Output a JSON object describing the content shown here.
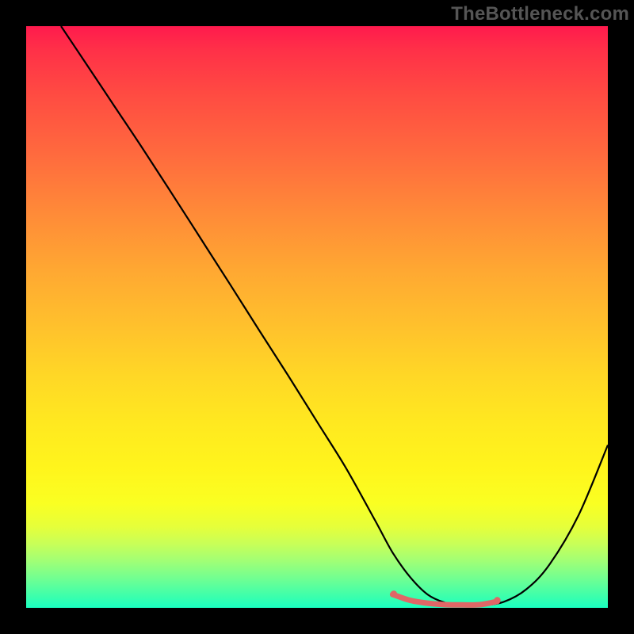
{
  "watermark": {
    "text": "TheBottleneck.com",
    "color": "#555555"
  },
  "chart_data": {
    "type": "line",
    "title": "",
    "xlabel": "",
    "ylabel": "",
    "xlim": [
      0,
      100
    ],
    "ylim": [
      0,
      100
    ],
    "series": [
      {
        "name": "curve",
        "stroke": "#000000",
        "stroke_width": 2.2,
        "x": [
          6,
          10,
          15,
          20,
          25,
          30,
          35,
          40,
          45,
          50,
          55,
          60,
          63,
          66,
          69,
          72,
          75,
          78,
          82,
          86,
          90,
          95,
          100
        ],
        "y": [
          100,
          94,
          86.5,
          79,
          71.3,
          63.5,
          55.7,
          47.8,
          40,
          32,
          24,
          15,
          9.5,
          5.3,
          2.3,
          0.9,
          0.4,
          0.4,
          1.0,
          3.2,
          7.5,
          16,
          28
        ]
      },
      {
        "name": "highlight",
        "stroke": "#e06666",
        "stroke_width": 7,
        "linecap": "round",
        "x": [
          63,
          66,
          69,
          72,
          75,
          78,
          81
        ],
        "y": [
          2.3,
          1.3,
          0.8,
          0.55,
          0.5,
          0.55,
          1.1
        ]
      }
    ],
    "markers": [
      {
        "x": 63.2,
        "y": 2.4,
        "r": 4.2,
        "fill": "#e06666"
      },
      {
        "x": 81.0,
        "y": 1.3,
        "r": 4.2,
        "fill": "#e06666"
      }
    ]
  }
}
